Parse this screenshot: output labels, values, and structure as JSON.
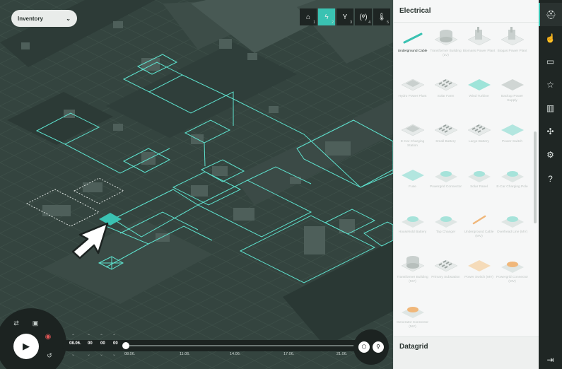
{
  "inventory_dropdown": {
    "label": "Inventory",
    "chevron": "chevron-down-icon"
  },
  "toolbar": [
    {
      "icon": "house-icon",
      "glyph": "⌂",
      "num": "1",
      "active": false
    },
    {
      "icon": "lightning-icon",
      "glyph": "ϟ",
      "num": "2",
      "active": true
    },
    {
      "icon": "water-icon",
      "glyph": "Y",
      "num": "3",
      "active": false
    },
    {
      "icon": "antenna-icon",
      "glyph": "(ᵠ)",
      "num": "4",
      "active": false
    },
    {
      "icon": "thermometer-icon",
      "glyph": "🌡",
      "num": "5",
      "active": false
    }
  ],
  "panel": {
    "title": "Electrical",
    "items": [
      {
        "label": "Underground Cable",
        "selected": true,
        "thumb": "cable",
        "color": "#3ac2b2"
      },
      {
        "label": "Transformer Building (LV)",
        "selected": false,
        "thumb": "tank",
        "color": "#c9d0ce"
      },
      {
        "label": "Biomass Power Plant",
        "selected": false,
        "thumb": "plant",
        "color": "#c9d0ce"
      },
      {
        "label": "Biogas Power Plant",
        "selected": false,
        "thumb": "plant",
        "color": "#c9d0ce"
      },
      {
        "label": "Hydro Power Plant",
        "selected": false,
        "thumb": "block",
        "color": "#c9d0ce"
      },
      {
        "label": "Solar Farm",
        "selected": false,
        "thumb": "solar",
        "color": "#c9d0ce"
      },
      {
        "label": "Wind Turbine",
        "selected": false,
        "thumb": "pad",
        "color": "#8ee0d4"
      },
      {
        "label": "Backup Power Supply",
        "selected": false,
        "thumb": "pad",
        "color": "#c9d0ce"
      },
      {
        "label": "E-Car Charging Station",
        "selected": false,
        "thumb": "block",
        "color": "#c9d0ce"
      },
      {
        "label": "Small Battery",
        "selected": false,
        "thumb": "solar",
        "color": "#c9d0ce"
      },
      {
        "label": "Large Battery",
        "selected": false,
        "thumb": "solar",
        "color": "#c9d0ce"
      },
      {
        "label": "Power Switch",
        "selected": false,
        "thumb": "pad",
        "color": "#a6e3da"
      },
      {
        "label": "Fuse",
        "selected": false,
        "thumb": "pad",
        "color": "#a6e3da"
      },
      {
        "label": "Powergrid Connector",
        "selected": false,
        "thumb": "disc",
        "color": "#a6e3da"
      },
      {
        "label": "Solar Panel",
        "selected": false,
        "thumb": "disc",
        "color": "#a6e3da"
      },
      {
        "label": "E-Car Charging Pole",
        "selected": false,
        "thumb": "disc",
        "color": "#a6e3da"
      },
      {
        "label": "Household Battery",
        "selected": false,
        "thumb": "disc",
        "color": "#a6e3da"
      },
      {
        "label": "Tap Changer",
        "selected": false,
        "thumb": "disc",
        "color": "#a6e3da"
      },
      {
        "label": "Underground Cable (MV)",
        "selected": false,
        "thumb": "line",
        "color": "#f0b77a"
      },
      {
        "label": "Overhead Line (MV)",
        "selected": false,
        "thumb": "disc",
        "color": "#a6e3da"
      },
      {
        "label": "Transformer Building (MV)",
        "selected": false,
        "thumb": "tank",
        "color": "#c9d0ce"
      },
      {
        "label": "Primary Substation",
        "selected": false,
        "thumb": "solar",
        "color": "#c9d0ce"
      },
      {
        "label": "Power Switch (MV)",
        "selected": false,
        "thumb": "pad",
        "color": "#f4d6ae"
      },
      {
        "label": "Powergrid Connector (MV)",
        "selected": false,
        "thumb": "disc",
        "color": "#f0b77a"
      },
      {
        "label": "Generator Connector (MV)",
        "selected": false,
        "thumb": "disc",
        "color": "#f0b77a"
      }
    ],
    "datagrid_title": "Datagrid"
  },
  "timeline": {
    "date": "08.06.",
    "hh": "00",
    "mm": "00",
    "ss": "00",
    "ticks": [
      "08.06.",
      "11.06.",
      "14.06.",
      "17.06.",
      "21.06."
    ]
  },
  "nav": [
    {
      "icon": "construction-icon",
      "glyph": "⛑",
      "active": true
    },
    {
      "icon": "hand-icon",
      "glyph": "☝",
      "active": false
    },
    {
      "icon": "browser-icon",
      "glyph": "▭",
      "active": false
    },
    {
      "icon": "star-icon",
      "glyph": "☆",
      "active": false
    },
    {
      "icon": "city-icon",
      "glyph": "▥",
      "active": false
    },
    {
      "icon": "puzzle-icon",
      "glyph": "✣",
      "active": false
    },
    {
      "icon": "settings-icon",
      "glyph": "⚙",
      "active": false
    },
    {
      "icon": "help-icon",
      "glyph": "?",
      "active": false
    },
    {
      "icon": "logout-icon",
      "glyph": "⇥",
      "active": false
    }
  ]
}
